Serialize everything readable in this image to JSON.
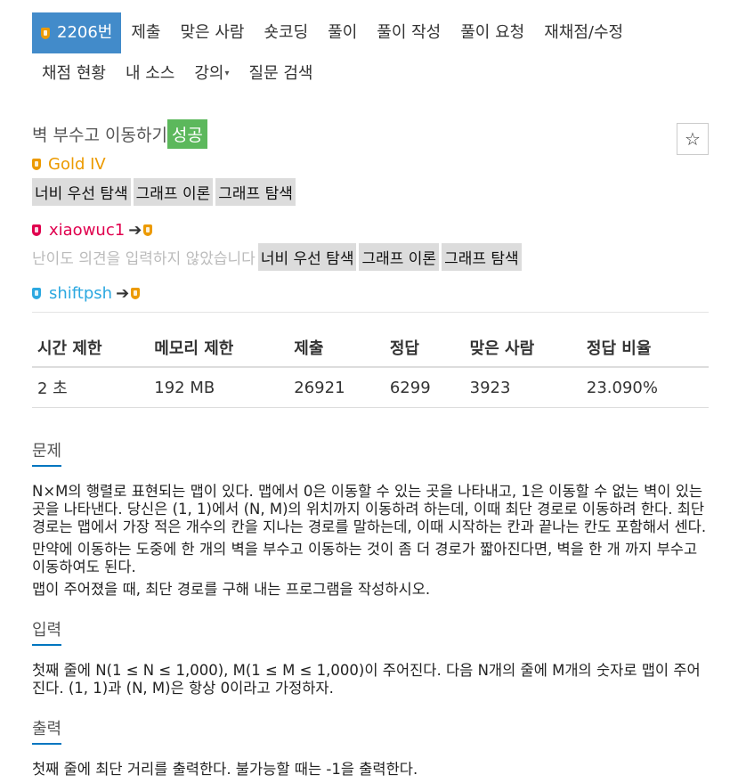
{
  "nav": {
    "row1": [
      {
        "label": "2206번",
        "active": true
      },
      {
        "label": "제출"
      },
      {
        "label": "맞은 사람"
      },
      {
        "label": "숏코딩"
      },
      {
        "label": "풀이"
      },
      {
        "label": "풀이 작성"
      },
      {
        "label": "풀이 요청"
      },
      {
        "label": "재채점/수정"
      }
    ],
    "row2": [
      {
        "label": "채점 현황"
      },
      {
        "label": "내 소스"
      },
      {
        "label": "강의"
      },
      {
        "label": "질문 검색"
      }
    ]
  },
  "problem": {
    "title": "벽 부수고 이동하기",
    "status_badge": "성공",
    "tier": "Gold IV",
    "tags": [
      "너비 우선 탐색",
      "그래프 이론",
      "그래프 탐색"
    ]
  },
  "contributions": [
    {
      "user": "xiaowuc1",
      "hint": "난이도 의견을 입력하지 않았습니다",
      "tags": [
        "너비 우선 탐색",
        "그래프 이론",
        "그래프 탐색"
      ]
    },
    {
      "user": "shiftpsh"
    }
  ],
  "stats": {
    "headers": [
      "시간 제한",
      "메모리 제한",
      "제출",
      "정답",
      "맞은 사람",
      "정답 비율"
    ],
    "values": [
      "2 초",
      "192 MB",
      "26921",
      "6299",
      "3923",
      "23.090%"
    ]
  },
  "sections": {
    "problem": {
      "heading": "문제",
      "paragraphs": [
        "N×M의 행렬로 표현되는 맵이 있다. 맵에서 0은 이동할 수 있는 곳을 나타내고, 1은 이동할 수 없는 벽이 있는 곳을 나타낸다. 당신은 (1, 1)에서 (N, M)의 위치까지 이동하려 하는데, 이때 최단 경로로 이동하려 한다. 최단경로는 맵에서 가장 적은 개수의 칸을 지나는 경로를 말하는데, 이때 시작하는 칸과 끝나는 칸도 포함해서 센다.",
        "만약에 이동하는 도중에 한 개의 벽을 부수고 이동하는 것이 좀 더 경로가 짧아진다면, 벽을 한 개 까지 부수고 이동하여도 된다.",
        "맵이 주어졌을 때, 최단 경로를 구해 내는 프로그램을 작성하시오."
      ]
    },
    "input": {
      "heading": "입력",
      "paragraphs": [
        "첫째 줄에 N(1 ≤ N ≤ 1,000), M(1 ≤ M ≤ 1,000)이 주어진다. 다음 N개의 줄에 M개의 숫자로 맵이 주어진다. (1, 1)과 (N, M)은 항상 0이라고 가정하자."
      ]
    },
    "output": {
      "heading": "출력",
      "paragraphs": [
        "첫째 줄에 최단 거리를 출력한다. 불가능할 때는 -1을 출력한다."
      ]
    }
  },
  "colors": {
    "active_tab": "#428bca",
    "success": "#5cb85c",
    "gold": "#ec9a00",
    "ruby_user": "#e0004e",
    "blue_user": "#2ca8e0"
  }
}
